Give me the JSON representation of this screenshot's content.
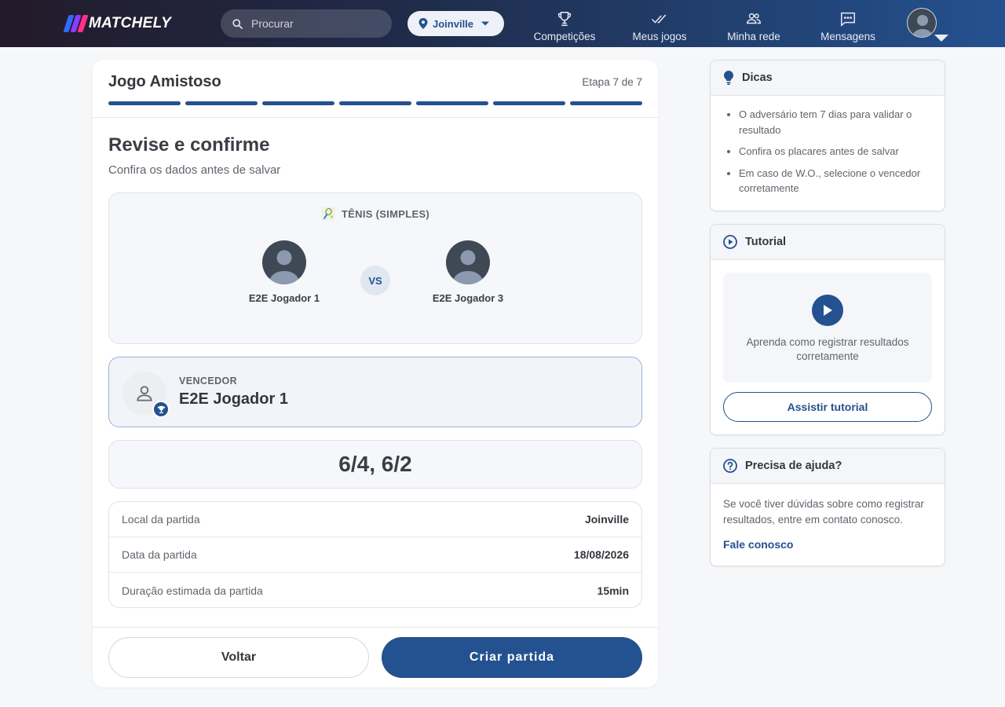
{
  "colors": {
    "primary": "#24518f",
    "logo_blue": "#2f6bff",
    "logo_purple": "#8a3cff",
    "logo_pink": "#ff2f8a"
  },
  "header": {
    "brand": "MATCHELY",
    "search": {
      "placeholder": "Procurar",
      "value": ""
    },
    "city": "Joinville",
    "nav": [
      {
        "label": "Competições",
        "icon": "trophy-icon"
      },
      {
        "label": "Meus jogos",
        "icon": "double-check-icon"
      },
      {
        "label": "Minha rede",
        "icon": "people-icon"
      },
      {
        "label": "Mensagens",
        "icon": "chat-icon"
      }
    ]
  },
  "wizard": {
    "title": "Jogo Amistoso",
    "step_label": "Etapa 7 de 7",
    "steps_completed": 7,
    "steps_total": 7
  },
  "review": {
    "title": "Revise e confirme",
    "subtitle": "Confira os dados antes de salvar",
    "sport": "TÊNIS (SIMPLES)",
    "player1": "E2E Jogador 1",
    "vs": "VS",
    "player2": "E2E Jogador 3",
    "winner_label": "VENCEDOR",
    "winner_name": "E2E Jogador 1",
    "score": "6/4, 6/2",
    "details": [
      {
        "label": "Local da partida",
        "value": "Joinville"
      },
      {
        "label": "Data da partida",
        "value": "18/08/2026"
      },
      {
        "label": "Duração estimada da partida",
        "value": "15min"
      }
    ],
    "back_label": "Voltar",
    "create_label": "Criar partida"
  },
  "tips": {
    "title": "Dicas",
    "items": [
      "O adversário tem 7 dias para validar o resultado",
      "Confira os placares antes de salvar",
      "Em caso de W.O., selecione o vencedor corretamente"
    ]
  },
  "tutorial": {
    "title": "Tutorial",
    "text": "Aprenda como registrar resultados corretamente",
    "button": "Assistir tutorial"
  },
  "help": {
    "title": "Precisa de ajuda?",
    "text": "Se você tiver dúvidas sobre como registrar resultados, entre em contato conosco.",
    "link": "Fale conosco"
  }
}
